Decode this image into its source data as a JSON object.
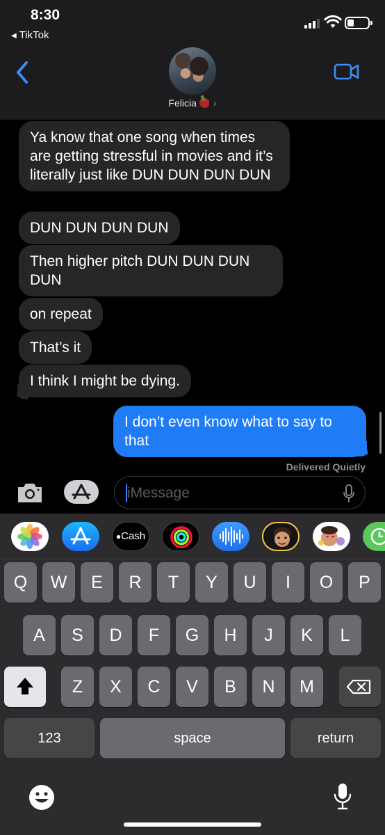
{
  "status_bar": {
    "time": "8:30",
    "back_app": "TikTok"
  },
  "header": {
    "contact_name": "Felicia",
    "chevron": "›"
  },
  "messages": [
    {
      "from": "them",
      "text": "Ya know that one song when times are getting stressful in movies and it’s literally just like DUN DUN DUN DUN"
    },
    {
      "from": "them",
      "text": "DUN DUN DUN DUN"
    },
    {
      "from": "them",
      "text": "Then higher pitch DUN DUN DUN DUN"
    },
    {
      "from": "them",
      "text": "on repeat"
    },
    {
      "from": "them",
      "text": "That’s it"
    },
    {
      "from": "them",
      "text": "I think I might be dying."
    },
    {
      "from": "me",
      "text": "I don’t even know what to say to that"
    }
  ],
  "delivery_status": "Delivered Quietly",
  "composer": {
    "placeholder": "iMessage"
  },
  "app_strip": [
    {
      "icon": "photos-icon"
    },
    {
      "icon": "appstore-icon"
    },
    {
      "icon": "apple-cash-icon",
      "label": "Cash"
    },
    {
      "icon": "activity-icon"
    },
    {
      "icon": "audio-message-icon"
    },
    {
      "icon": "memoji-icon"
    },
    {
      "icon": "memoji-stickers-icon"
    },
    {
      "icon": "clock-icon"
    }
  ],
  "keyboard": {
    "row1": [
      "Q",
      "W",
      "E",
      "R",
      "T",
      "Y",
      "U",
      "I",
      "O",
      "P"
    ],
    "row2": [
      "A",
      "S",
      "D",
      "F",
      "G",
      "H",
      "J",
      "K",
      "L"
    ],
    "row3": [
      "Z",
      "X",
      "C",
      "V",
      "B",
      "N",
      "M"
    ],
    "numbers_key": "123",
    "space_key": "space",
    "return_key": "return"
  },
  "colors": {
    "sent_bubble": "#1f7cf6",
    "received_bubble": "#262629",
    "accent": "#3c8cf8"
  }
}
